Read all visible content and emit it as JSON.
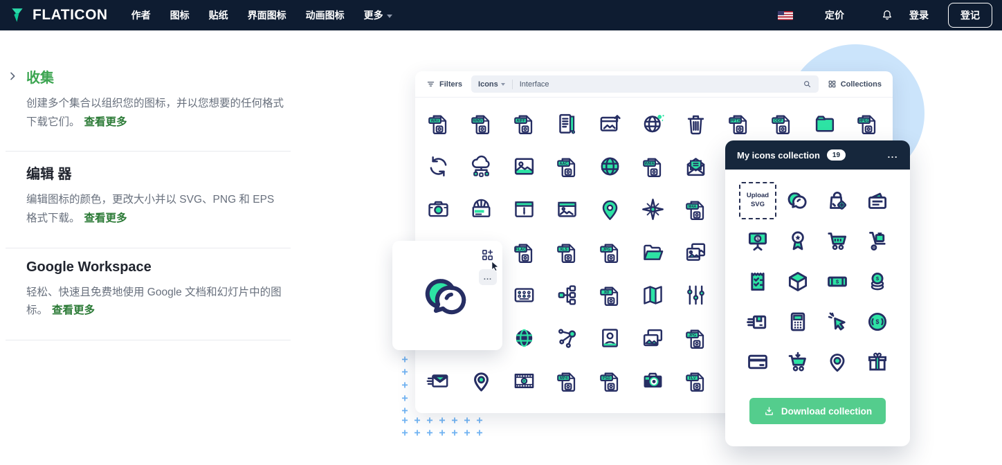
{
  "navbar": {
    "brand": "FLATICON",
    "menu": [
      {
        "label": "作者"
      },
      {
        "label": "图标"
      },
      {
        "label": "贴纸"
      },
      {
        "label": "界面图标"
      },
      {
        "label": "动画图标"
      },
      {
        "label": "更多",
        "caret": true
      }
    ],
    "pricing": "定价",
    "login": "登录",
    "signup": "登记",
    "flag": "us-flag"
  },
  "features": [
    {
      "title": "收集",
      "active": true,
      "chevron": true,
      "description": "创建多个集合以组织您的图标，并以您想要的任何格式下载它们。",
      "link": "查看更多"
    },
    {
      "title": "编辑 器",
      "active": false,
      "chevron": false,
      "description": "编辑图标的颜色，更改大小并以 SVG、PNG 和 EPS 格式下载。",
      "link": "查看更多"
    },
    {
      "title": "Google Workspace",
      "active": false,
      "chevron": false,
      "description": "轻松、快速且免费地使用 Google 文档和幻灯片中的图标。",
      "link": "查看更多"
    }
  ],
  "mockup": {
    "toolbar": {
      "filters_label": "Filters",
      "scope_label": "Icons",
      "query": "Interface",
      "collections_label": "Collections"
    },
    "grid_rows": [
      {
        "r": 0,
        "cells": [
          {
            "c": 0,
            "name": "wav-file",
            "label": "WAV"
          },
          {
            "c": 1,
            "name": "wmv-file",
            "label": "WMV"
          },
          {
            "c": 2,
            "name": "aiff-file",
            "label": "AIFF"
          },
          {
            "c": 3,
            "name": "document"
          },
          {
            "c": 4,
            "name": "browser-upload"
          },
          {
            "c": 5,
            "name": "globe-sketch"
          },
          {
            "c": 6,
            "name": "trash"
          },
          {
            "c": 7,
            "name": "pptx-file",
            "label": "PPTX"
          },
          {
            "c": 8,
            "name": "odp-file",
            "label": "ODP"
          },
          {
            "c": 9,
            "name": "folder"
          },
          {
            "c": 10,
            "name": "mpeg-file",
            "label": "MPEG"
          }
        ]
      },
      {
        "r": 1,
        "cells": [
          {
            "c": 0,
            "name": "sync"
          },
          {
            "c": 1,
            "name": "cloud-network"
          },
          {
            "c": 2,
            "name": "photo"
          },
          {
            "c": 3,
            "name": "aac-file",
            "label": "AAC"
          },
          {
            "c": 4,
            "name": "globe"
          },
          {
            "c": 5,
            "name": "wma-file",
            "label": "WMA"
          },
          {
            "c": 6,
            "name": "open-mail"
          }
        ]
      },
      {
        "r": 2,
        "cells": [
          {
            "c": 0,
            "name": "photo-camera"
          },
          {
            "c": 1,
            "name": "awning-window"
          },
          {
            "c": 2,
            "name": "browser-edit"
          },
          {
            "c": 3,
            "name": "browser-photo"
          },
          {
            "c": 4,
            "name": "location-pin"
          },
          {
            "c": 5,
            "name": "compass"
          },
          {
            "c": 6,
            "name": "m4a-file",
            "label": "M4A"
          }
        ]
      },
      {
        "r": 3,
        "cells": [
          {
            "c": 2,
            "name": "flac-file",
            "label": "FLAC"
          },
          {
            "c": 3,
            "name": "xls-file",
            "label": "XLS"
          },
          {
            "c": 4,
            "name": "jpg-document",
            "label": "JPG"
          },
          {
            "c": 5,
            "name": "open-folder"
          },
          {
            "c": 6,
            "name": "photo-gallery"
          }
        ]
      },
      {
        "r": 4,
        "cells": [
          {
            "c": 2,
            "name": "keypad"
          },
          {
            "c": 3,
            "name": "hierarchy"
          },
          {
            "c": 4,
            "name": "xd-file",
            "label": "XD"
          },
          {
            "c": 5,
            "name": "map"
          },
          {
            "c": 6,
            "name": "sliders"
          }
        ]
      },
      {
        "r": 5,
        "cells": [
          {
            "c": 2,
            "name": "globe-dark"
          },
          {
            "c": 3,
            "name": "share-network"
          },
          {
            "c": 4,
            "name": "portrait"
          },
          {
            "c": 5,
            "name": "photo-stack"
          },
          {
            "c": 6,
            "name": "jpg-file",
            "label": "JPG"
          }
        ]
      },
      {
        "r": 6,
        "cells": [
          {
            "c": 0,
            "name": "mail-send"
          },
          {
            "c": 1,
            "name": "pin-outline"
          },
          {
            "c": 2,
            "name": "film-strip"
          },
          {
            "c": 3,
            "name": "mp4-file",
            "label": "MP4"
          },
          {
            "c": 4,
            "name": "psd-file",
            "label": "PSD"
          },
          {
            "c": 5,
            "name": "camera-dark"
          },
          {
            "c": 6,
            "name": "flv-file",
            "label": "FLV"
          }
        ]
      }
    ]
  },
  "hover_card": {
    "icon": "chat-bubbles",
    "more_label": "..."
  },
  "panel": {
    "title": "My icons collection",
    "count": "19",
    "menu_label": "...",
    "upload_line1": "Upload",
    "upload_line2": "SVG",
    "download_label": "Download collection",
    "cells": [
      {
        "name": "upload-svg",
        "upload": true
      },
      {
        "name": "chat-bubbles"
      },
      {
        "name": "bag-add"
      },
      {
        "name": "wallet"
      },
      {
        "name": "billboard-dollar"
      },
      {
        "name": "award-badge"
      },
      {
        "name": "shopping-cart"
      },
      {
        "name": "hand-truck"
      },
      {
        "name": "receipt-check"
      },
      {
        "name": "package-box"
      },
      {
        "name": "banknote"
      },
      {
        "name": "coin-stack"
      },
      {
        "name": "shipping-box"
      },
      {
        "name": "calculator"
      },
      {
        "name": "cursor-click"
      },
      {
        "name": "dollar-coin"
      },
      {
        "name": "credit-card"
      },
      {
        "name": "cart-download"
      },
      {
        "name": "pin-round"
      },
      {
        "name": "gift-box"
      }
    ]
  },
  "colors": {
    "navbar_bg": "#0e1c31",
    "accent_green": "#3ca551",
    "link_green": "#2b7a36",
    "icon_navy": "#262e63",
    "icon_mint": "#2de3a4",
    "panel_header_navy": "#16273c",
    "download_green": "#54cd8d",
    "circle_blue": "#cbe4fb",
    "plus_blue": "#6fb3f3"
  }
}
